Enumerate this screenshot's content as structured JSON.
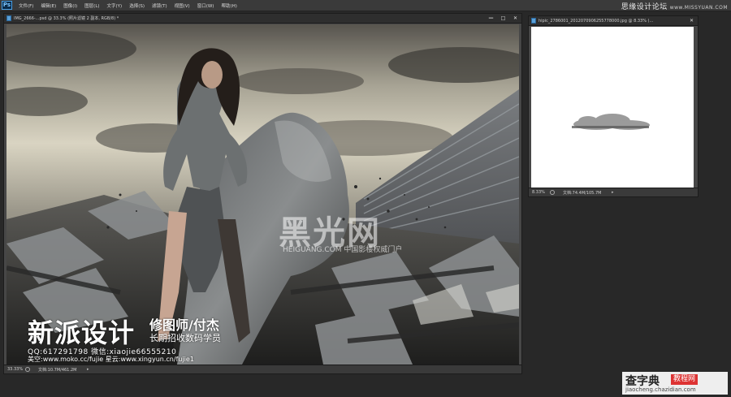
{
  "menubar": {
    "logo": "Ps",
    "items": [
      "文件(F)",
      "编辑(E)",
      "图像(I)",
      "图层(L)",
      "文字(Y)",
      "选择(S)",
      "滤镜(T)",
      "视图(V)",
      "窗口(W)",
      "帮助(H)"
    ],
    "watermark_zh": "思缘设计论坛",
    "watermark_url": "www.MISSYUAN.COM"
  },
  "main_window": {
    "title": "IMG_2666-...psd @ 33.3% (照片滤镜 2 副本, RGB/8) *",
    "zoom": "33.33%",
    "doc_size": "文档:10.7M/461.2M"
  },
  "side_window": {
    "title": "hipic_2786001_2012070906255778000.jpg @ 8.33% (...",
    "zoom": "8.33%",
    "doc_size": "文档:74.4M/105.7M"
  },
  "photo_text": {
    "brand": "新派设计",
    "retoucher": "修图师/付杰",
    "recruit": "长期招收数码学员",
    "contact_line1": "QQ:617291798  微信:xiaojie66555210",
    "contact_line2": "美空:www.moko.cc/fujie  星云:www.xingyun.cn/fujie1",
    "watermark_big": "黑光网",
    "watermark_small": "HEIGUANG.COM 中国影楼权威门户"
  },
  "bottom_watermark": {
    "title": "查字典",
    "badge": "教程网",
    "url": "jiaocheng.chazidian.com"
  },
  "colors": {
    "app_bg": "#282828",
    "menubar_bg": "#3a3a3a",
    "window_frame": "#474747",
    "sky_top": "#6e6a62",
    "sky_light": "#d9d4c2",
    "accent_badge": "#dd3333"
  }
}
